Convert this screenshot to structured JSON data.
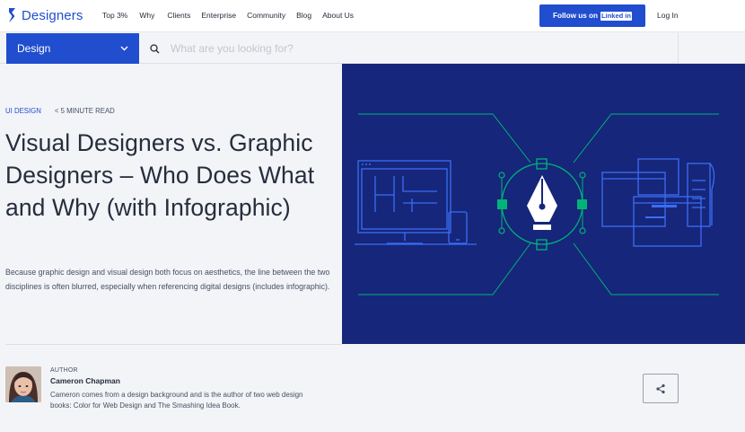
{
  "header": {
    "logo_text": "Designers",
    "nav": [
      "Top 3%",
      "Why",
      "Clients",
      "Enterprise",
      "Community",
      "Blog",
      "About Us"
    ],
    "cta_label": "Follow us on",
    "cta_badge": "Linked in",
    "login_label": "Log In"
  },
  "subbar": {
    "category": "Design",
    "search_placeholder": "What are you looking for?"
  },
  "article": {
    "category": "UI DESIGN",
    "read_time": "< 5 MINUTE READ",
    "title": "Visual Designers vs. Graphic Designers – Who Does What and Why (with Infographic)",
    "excerpt": "Because graphic design and visual design both focus on aesthetics, the line between the two disciplines is often blurred, especially when referencing digital designs (includes infographic)."
  },
  "author": {
    "label": "AUTHOR",
    "name": "Cameron Chapman",
    "bio": "Cameron comes from a design background and is the author of two web design books: Color for Web Design and The Smashing Idea Book."
  },
  "colors": {
    "brand_blue": "#204ecf",
    "illustration_bg": "#16267a",
    "accent_green": "#00cc83"
  },
  "icons": [
    "logo-icon",
    "chevron-down-icon",
    "search-icon",
    "share-icon"
  ]
}
